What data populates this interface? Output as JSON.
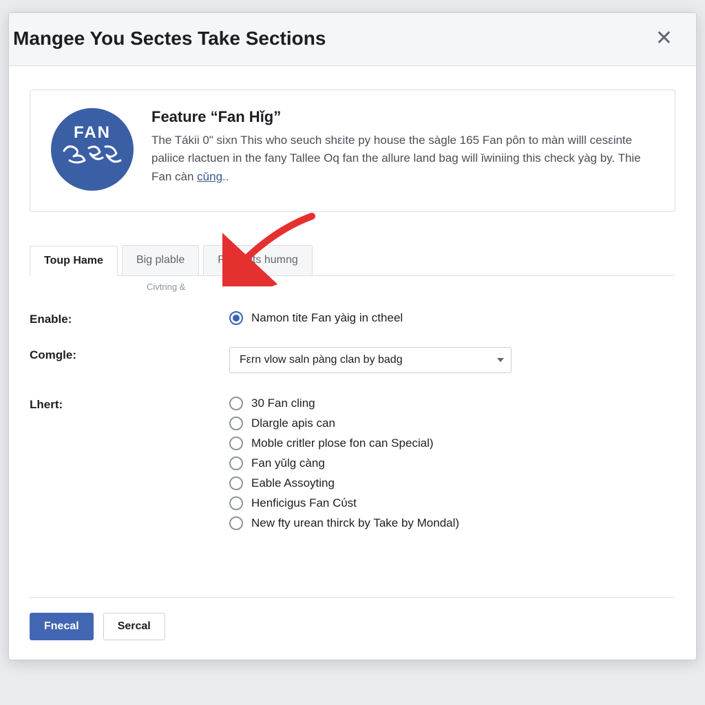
{
  "modal": {
    "title": "Mangee You Sectes Take Sections",
    "close_glyph": "✕"
  },
  "feature": {
    "badge_top": "FAN",
    "title": "Feature “Fan Hǐg”",
    "description": "The Tákii 0\" sixn This who seuch shεite py house the sàgle 165 Fan pȏn to màn willl cesεinte paliice rlactuen in the fany Tallee Oq fan the allure land bag will ǐwiniing this check yàg by. Thie Fan càn ",
    "link_label": "cǔng"
  },
  "tabs": [
    {
      "label": "Toup Hame",
      "active": true
    },
    {
      "label": "Big plable",
      "active": false
    },
    {
      "label": "Renlants humng",
      "active": false
    }
  ],
  "subnote": "Civtring &",
  "form": {
    "enable_label": "Enable:",
    "enable_option": "Namon tite Fan yàig in ctheel",
    "comgle_label": "Comgle:",
    "comgle_value": "Fεrn vlow saln pàng clan by badg",
    "lhert_label": "Lhert:",
    "lhert_options": [
      "30 Fan cling",
      "Dlargle apis can",
      "Moble critler plose fon can Special)",
      "Fan yǔlg càng",
      "Eable Assoyting",
      "Henficigus Fan Cύst",
      "New fty urean thirck by Take by Mondal)"
    ]
  },
  "footer": {
    "primary": "Fnecal",
    "secondary": "Sercal"
  }
}
